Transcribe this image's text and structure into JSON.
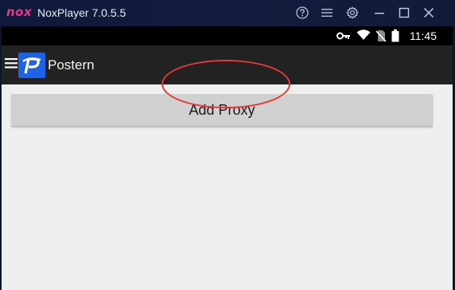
{
  "window": {
    "logo_text": "nox",
    "title": "NoxPlayer 7.0.5.5",
    "controls": [
      "help-icon",
      "menu-icon",
      "settings-icon",
      "minimize-icon",
      "maximize-icon",
      "close-icon"
    ]
  },
  "status_bar": {
    "icons": [
      "vpn-key-icon",
      "wifi-icon",
      "no-sim-icon",
      "battery-icon"
    ],
    "time": "11:45"
  },
  "app_bar": {
    "title": "Postern",
    "logo_letter": "P"
  },
  "main": {
    "add_proxy_label": "Add Proxy"
  },
  "colors": {
    "accent": "#1e62e6",
    "highlight": "#e53935",
    "app_bar": "#222222",
    "background": "#efefef",
    "button": "#d0d0d0"
  }
}
